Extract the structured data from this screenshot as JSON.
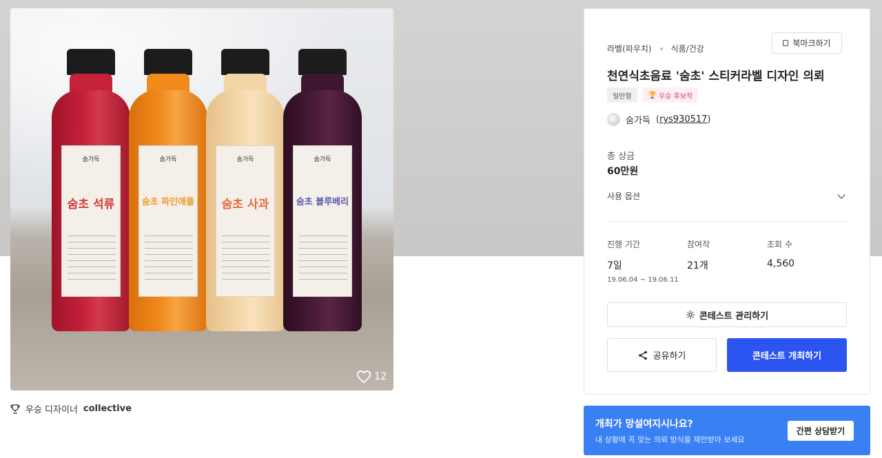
{
  "product": {
    "like_count": "12",
    "bottles": [
      {
        "brand": "숨가득",
        "name": "숨초 석류",
        "color": "#c5213a",
        "name_color": "#d23a3a"
      },
      {
        "brand": "숨가득",
        "name": "숨초 파인애플",
        "color": "#f08a1c",
        "name_color": "#f09a28"
      },
      {
        "brand": "숨가득",
        "name": "숨초 사과",
        "color": "#f3d6a8",
        "name_color": "#e56a3a"
      },
      {
        "brand": "숨가득",
        "name": "숨초 블루베리",
        "color": "#3f1630",
        "name_color": "#5a5ab0"
      }
    ]
  },
  "award": {
    "prefix": "우승 디자이너",
    "name": "collective"
  },
  "contest": {
    "category_main": "라벨(파우치)",
    "category_sub": "식품/건강",
    "bookmark_label": "북마크하기",
    "title": "천연식초음료 '숨초' 스티커라벨 디자인 의뢰",
    "badge_type": "일반형",
    "badge_award": "우승 후보작",
    "author_name": "숨가득",
    "author_id": "rys930517",
    "prize_label": "총 상금",
    "prize_value": "60만원",
    "options_label": "사용 옵션",
    "stats": {
      "period_label": "진행 기간",
      "period_value": "7일",
      "period_range": "19.06.04 ~ 19.06.11",
      "participants_label": "참여작",
      "participants_value": "21개",
      "views_label": "조회 수",
      "views_value": "4,560"
    },
    "manage_label": "콘테스트 관리하기",
    "share_label": "공유하기",
    "host_label": "콘테스트 개최하기",
    "colors": {
      "primary": "#2c54f0",
      "award_pink": "#d6387f"
    }
  },
  "consult": {
    "question": "개최가 망설여지시나요?",
    "desc": "내 상황에 꼭 맞는 의뢰 방식을 제안받아 보세요",
    "button": "간편 상담받기",
    "color": "#3a80f5"
  }
}
